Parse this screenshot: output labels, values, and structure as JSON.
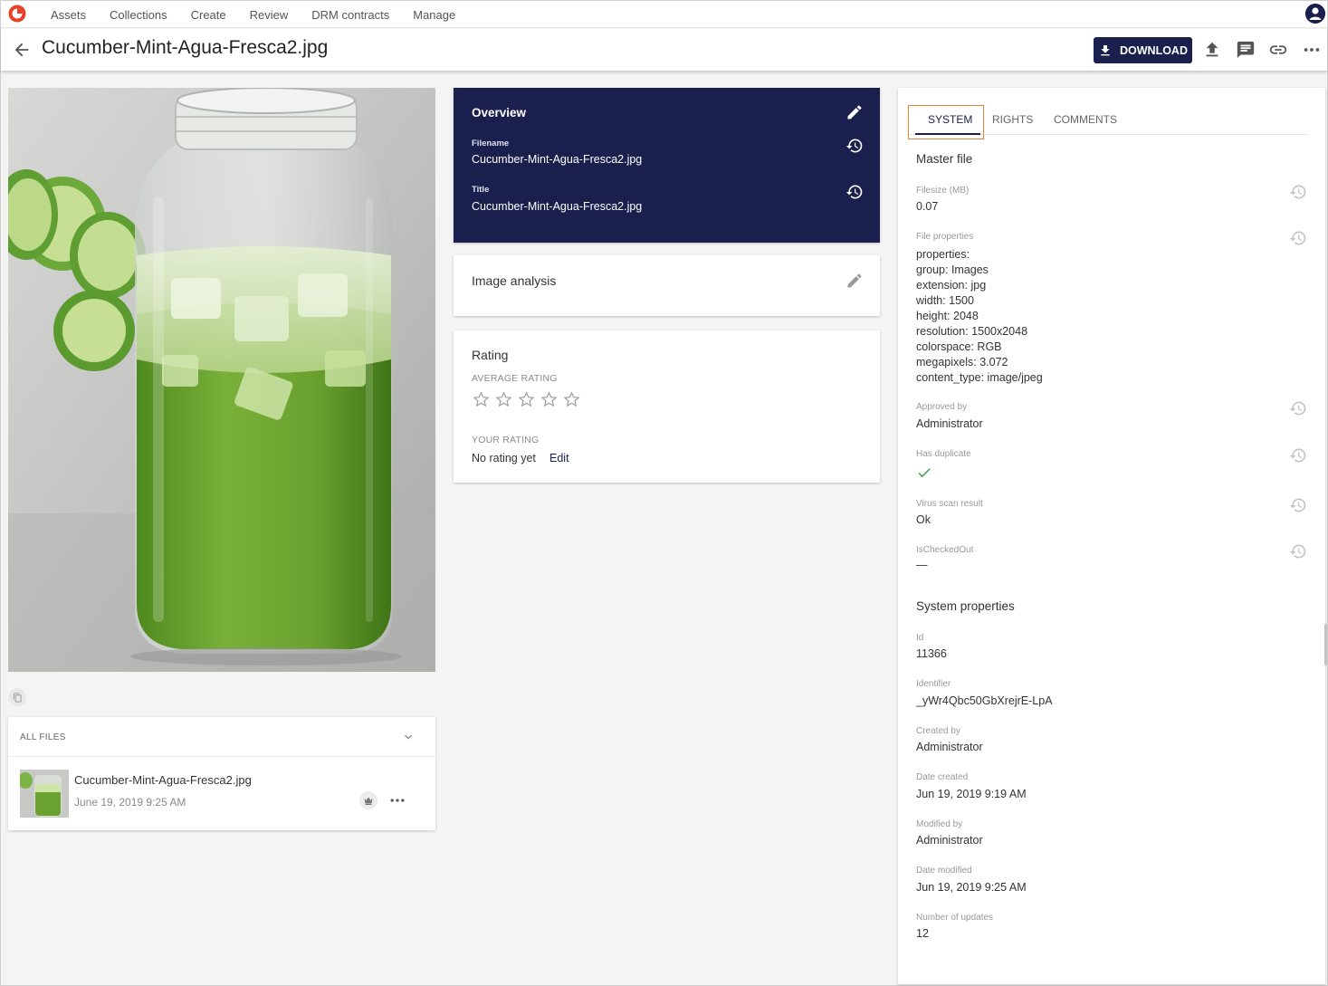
{
  "nav": {
    "items": [
      "Assets",
      "Collections",
      "Create",
      "Review",
      "DRM contracts",
      "Manage"
    ]
  },
  "header": {
    "title": "Cucumber-Mint-Agua-Fresca2.jpg",
    "download_label": "DOWNLOAD"
  },
  "files": {
    "header": "ALL FILES",
    "items": [
      {
        "name": "Cucumber-Mint-Agua-Fresca2.jpg",
        "date": "June 19, 2019 9:25 AM"
      }
    ]
  },
  "overview": {
    "title": "Overview",
    "fields": [
      {
        "label": "Filename",
        "value": "Cucumber-Mint-Agua-Fresca2.jpg"
      },
      {
        "label": "Title",
        "value": "Cucumber-Mint-Agua-Fresca2.jpg"
      }
    ]
  },
  "image_analysis": {
    "title": "Image analysis"
  },
  "rating": {
    "title": "Rating",
    "average_label": "AVERAGE RATING",
    "average_value": 0,
    "max_stars": 5,
    "your_label": "YOUR RATING",
    "your_value": "No rating yet",
    "edit_label": "Edit"
  },
  "tabs": [
    "SYSTEM",
    "RIGHTS",
    "COMMENTS"
  ],
  "master_file": {
    "title": "Master file",
    "filesize_label": "Filesize (MB)",
    "filesize_value": "0.07",
    "file_properties_label": "File properties",
    "file_properties": [
      {
        "key": "properties:",
        "value": ""
      },
      {
        "key": "group:",
        "value": "Images"
      },
      {
        "key": "extension:",
        "value": "jpg"
      },
      {
        "key": "width:",
        "value": "1500"
      },
      {
        "key": "height:",
        "value": "2048"
      },
      {
        "key": "resolution:",
        "value": "1500x2048"
      },
      {
        "key": "colorspace:",
        "value": "RGB"
      },
      {
        "key": "megapixels:",
        "value": "3.072"
      },
      {
        "key": "content_type:",
        "value": "image/jpeg"
      }
    ],
    "approved_by_label": "Approved by",
    "approved_by_value": "Administrator",
    "has_duplicate_label": "Has duplicate",
    "has_duplicate_value": true,
    "virus_label": "Virus scan result",
    "virus_value": "Ok",
    "checked_out_label": "IsCheckedOut",
    "checked_out_value": "—"
  },
  "system_properties": {
    "title": "System properties",
    "fields": [
      {
        "label": "Id",
        "value": "11366"
      },
      {
        "label": "Identifier",
        "value": "_yWr4Qbc50GbXrejrE-LpA"
      },
      {
        "label": "Created by",
        "value": "Administrator"
      },
      {
        "label": "Date created",
        "value": "Jun 19, 2019 9:19 AM"
      },
      {
        "label": "Modified by",
        "value": "Administrator"
      },
      {
        "label": "Date modified",
        "value": "Jun 19, 2019 9:25 AM"
      },
      {
        "label": "Number of updates",
        "value": "12"
      }
    ]
  },
  "colors": {
    "brand_navy": "#1a1f4d",
    "logo_red": "#e8412a",
    "focus_orange": "#e8843a",
    "check_green": "#43a047"
  }
}
